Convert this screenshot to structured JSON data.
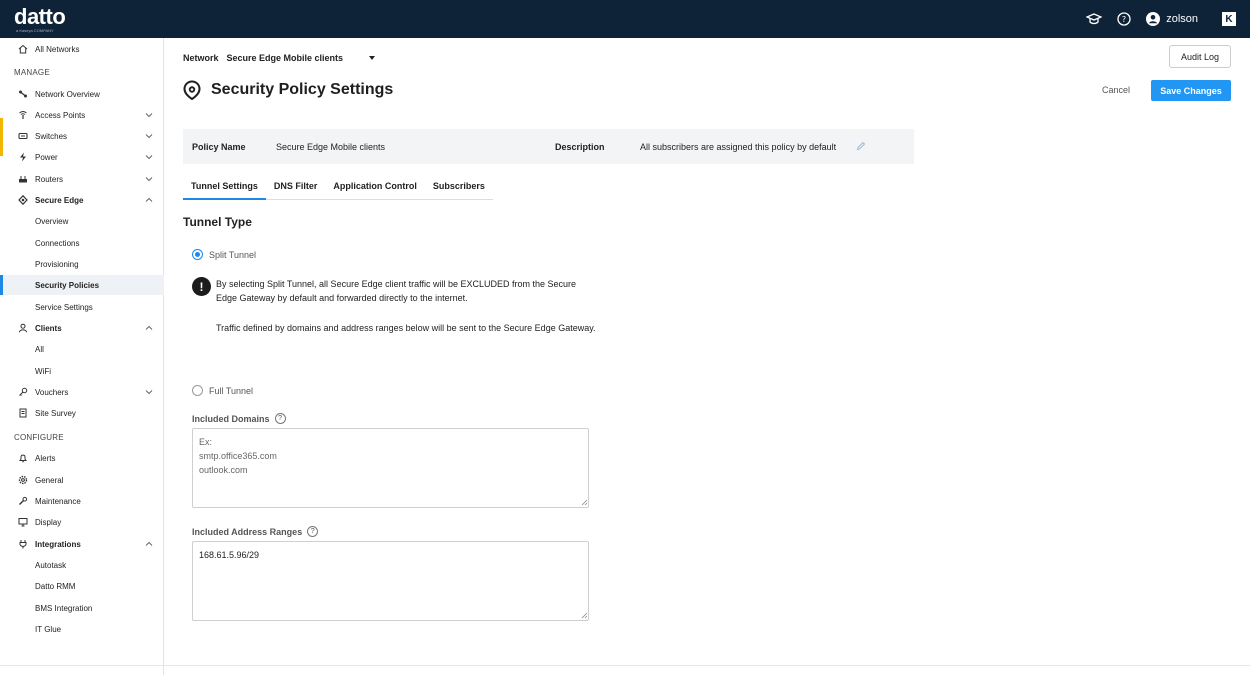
{
  "header": {
    "logo": "datto",
    "logo_sub": "a Kaseya COMPANY",
    "username": "zolson",
    "brand_badge": "K"
  },
  "sidebar": {
    "all_networks": "All Networks",
    "manage_label": "MANAGE",
    "configure_label": "CONFIGURE",
    "items": [
      {
        "label": "Network Overview"
      },
      {
        "label": "Access Points"
      },
      {
        "label": "Switches"
      },
      {
        "label": "Power"
      },
      {
        "label": "Routers"
      },
      {
        "label": "Secure Edge"
      },
      {
        "label": "Overview"
      },
      {
        "label": "Connections"
      },
      {
        "label": "Provisioning"
      },
      {
        "label": "Security Policies"
      },
      {
        "label": "Service Settings"
      },
      {
        "label": "Clients"
      },
      {
        "label": "All"
      },
      {
        "label": "WiFi"
      },
      {
        "label": "Vouchers"
      },
      {
        "label": "Site Survey"
      },
      {
        "label": "Alerts"
      },
      {
        "label": "General"
      },
      {
        "label": "Maintenance"
      },
      {
        "label": "Display"
      },
      {
        "label": "Integrations"
      },
      {
        "label": "Autotask"
      },
      {
        "label": "Datto RMM"
      },
      {
        "label": "BMS Integration"
      },
      {
        "label": "IT Glue"
      }
    ]
  },
  "main": {
    "network_label": "Network",
    "network_value": "Secure Edge Mobile clients",
    "audit_log": "Audit Log",
    "title": "Security Policy Settings",
    "cancel": "Cancel",
    "save": "Save Changes",
    "policy_name_label": "Policy Name",
    "policy_name_value": "Secure Edge Mobile clients",
    "description_label": "Description",
    "description_value": "All subscribers are assigned this policy by default",
    "tabs": [
      {
        "label": "Tunnel Settings"
      },
      {
        "label": "DNS Filter"
      },
      {
        "label": "Application Control"
      },
      {
        "label": "Subscribers"
      }
    ],
    "tunnel_type": "Tunnel Type",
    "split_tunnel": "Split Tunnel",
    "notice_1": "By selecting Split Tunnel, all Secure Edge client traffic will be EXCLUDED from the Secure Edge Gateway by default and forwarded directly to the internet.",
    "notice_2": "Traffic defined by domains and address ranges below will be sent to the Secure Edge Gateway.",
    "full_tunnel": "Full Tunnel",
    "included_domains": "Included Domains",
    "domains_placeholder": "Ex:\nsmtp.office365.com\noutlook.com",
    "included_ranges": "Included Address Ranges",
    "ranges_value": "168.61.5.96/29"
  }
}
